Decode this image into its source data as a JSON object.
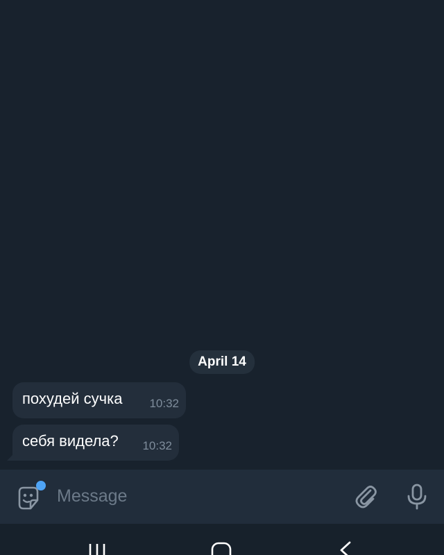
{
  "chat": {
    "date_separator": "April 14",
    "messages": [
      {
        "text": "похудей сучка",
        "time": "10:32"
      },
      {
        "text": "себя видела?",
        "time": "10:32"
      }
    ]
  },
  "input": {
    "placeholder": "Message",
    "icons": {
      "emoji": "sticker-emoji-icon",
      "attach": "paperclip-icon",
      "voice": "microphone-icon"
    }
  },
  "navigation": {
    "icons": [
      "recents-icon",
      "home-icon",
      "back-icon"
    ]
  },
  "colors": {
    "background": "#18222d",
    "bubble": "#232e3b",
    "input_bar": "#212d3b",
    "nav_bar": "#17212b",
    "accent_dot": "#4ea4f6",
    "muted_text": "#7f8d9c"
  }
}
